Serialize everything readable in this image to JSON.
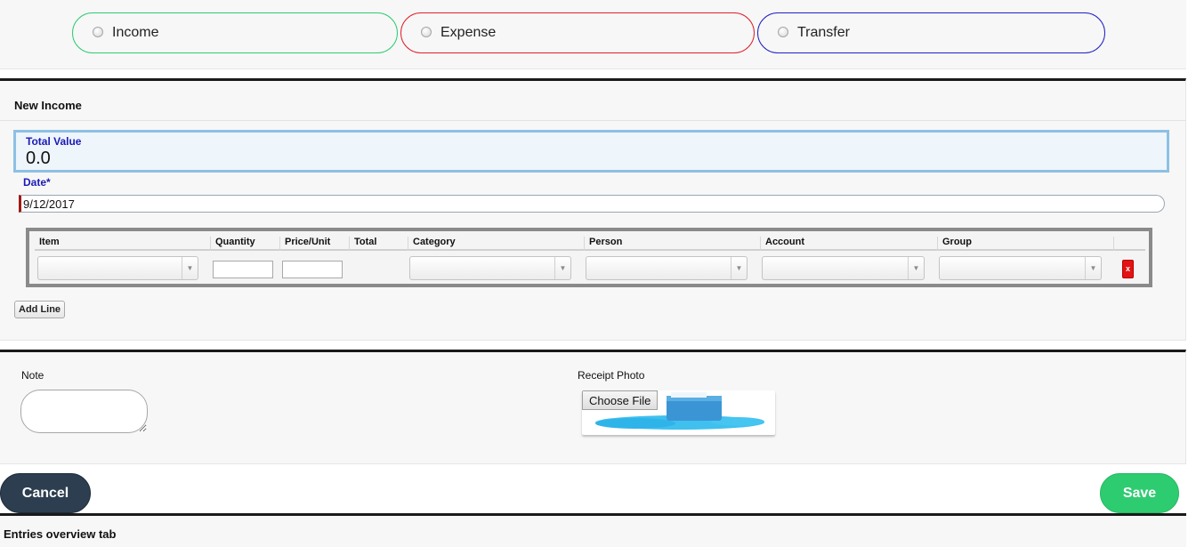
{
  "entry_types": [
    {
      "label": "Income",
      "selected": false,
      "color": "#2ecc71"
    },
    {
      "label": "Expense",
      "selected": false,
      "color": "#e0202a"
    },
    {
      "label": "Transfer",
      "selected": false,
      "color": "#1f1fc4"
    }
  ],
  "form": {
    "title": "New Income",
    "total_label": "Total Value",
    "total_value": "0.0",
    "date_label": "Date*",
    "date_value": "9/12/2017"
  },
  "lines_table": {
    "columns": [
      "Item",
      "Quantity",
      "Price/Unit",
      "Total",
      "Category",
      "Person",
      "Account",
      "Group"
    ],
    "rows": [
      {
        "item": "",
        "quantity": "",
        "price_unit": "",
        "total": "",
        "category": "",
        "person": "",
        "account": "",
        "group": ""
      }
    ],
    "delete_label": "x",
    "add_line_label": "Add Line"
  },
  "extras": {
    "note_label": "Note",
    "note_value": "",
    "receipt_label": "Receipt Photo",
    "choose_file_label": "Choose File"
  },
  "actions": {
    "cancel_label": "Cancel",
    "save_label": "Save"
  },
  "overview": {
    "label": "Entries overview tab"
  },
  "colors": {
    "accent_blue_label": "#1a1ab8",
    "save": "#2ecc71",
    "cancel": "#2c3e50",
    "delete": "#e41414"
  }
}
